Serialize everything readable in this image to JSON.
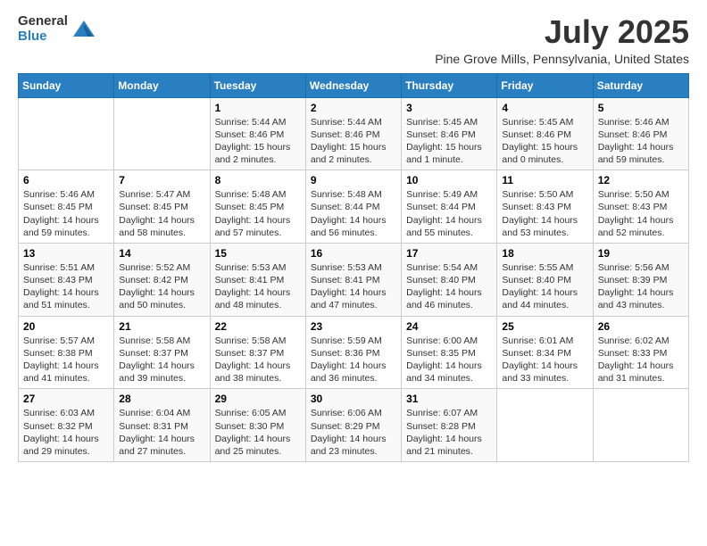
{
  "logo": {
    "general": "General",
    "blue": "Blue"
  },
  "title": "July 2025",
  "subtitle": "Pine Grove Mills, Pennsylvania, United States",
  "days_of_week": [
    "Sunday",
    "Monday",
    "Tuesday",
    "Wednesday",
    "Thursday",
    "Friday",
    "Saturday"
  ],
  "weeks": [
    [
      {
        "day": "",
        "info": ""
      },
      {
        "day": "",
        "info": ""
      },
      {
        "day": "1",
        "info": "Sunrise: 5:44 AM\nSunset: 8:46 PM\nDaylight: 15 hours and 2 minutes."
      },
      {
        "day": "2",
        "info": "Sunrise: 5:44 AM\nSunset: 8:46 PM\nDaylight: 15 hours and 2 minutes."
      },
      {
        "day": "3",
        "info": "Sunrise: 5:45 AM\nSunset: 8:46 PM\nDaylight: 15 hours and 1 minute."
      },
      {
        "day": "4",
        "info": "Sunrise: 5:45 AM\nSunset: 8:46 PM\nDaylight: 15 hours and 0 minutes."
      },
      {
        "day": "5",
        "info": "Sunrise: 5:46 AM\nSunset: 8:46 PM\nDaylight: 14 hours and 59 minutes."
      }
    ],
    [
      {
        "day": "6",
        "info": "Sunrise: 5:46 AM\nSunset: 8:45 PM\nDaylight: 14 hours and 59 minutes."
      },
      {
        "day": "7",
        "info": "Sunrise: 5:47 AM\nSunset: 8:45 PM\nDaylight: 14 hours and 58 minutes."
      },
      {
        "day": "8",
        "info": "Sunrise: 5:48 AM\nSunset: 8:45 PM\nDaylight: 14 hours and 57 minutes."
      },
      {
        "day": "9",
        "info": "Sunrise: 5:48 AM\nSunset: 8:44 PM\nDaylight: 14 hours and 56 minutes."
      },
      {
        "day": "10",
        "info": "Sunrise: 5:49 AM\nSunset: 8:44 PM\nDaylight: 14 hours and 55 minutes."
      },
      {
        "day": "11",
        "info": "Sunrise: 5:50 AM\nSunset: 8:43 PM\nDaylight: 14 hours and 53 minutes."
      },
      {
        "day": "12",
        "info": "Sunrise: 5:50 AM\nSunset: 8:43 PM\nDaylight: 14 hours and 52 minutes."
      }
    ],
    [
      {
        "day": "13",
        "info": "Sunrise: 5:51 AM\nSunset: 8:43 PM\nDaylight: 14 hours and 51 minutes."
      },
      {
        "day": "14",
        "info": "Sunrise: 5:52 AM\nSunset: 8:42 PM\nDaylight: 14 hours and 50 minutes."
      },
      {
        "day": "15",
        "info": "Sunrise: 5:53 AM\nSunset: 8:41 PM\nDaylight: 14 hours and 48 minutes."
      },
      {
        "day": "16",
        "info": "Sunrise: 5:53 AM\nSunset: 8:41 PM\nDaylight: 14 hours and 47 minutes."
      },
      {
        "day": "17",
        "info": "Sunrise: 5:54 AM\nSunset: 8:40 PM\nDaylight: 14 hours and 46 minutes."
      },
      {
        "day": "18",
        "info": "Sunrise: 5:55 AM\nSunset: 8:40 PM\nDaylight: 14 hours and 44 minutes."
      },
      {
        "day": "19",
        "info": "Sunrise: 5:56 AM\nSunset: 8:39 PM\nDaylight: 14 hours and 43 minutes."
      }
    ],
    [
      {
        "day": "20",
        "info": "Sunrise: 5:57 AM\nSunset: 8:38 PM\nDaylight: 14 hours and 41 minutes."
      },
      {
        "day": "21",
        "info": "Sunrise: 5:58 AM\nSunset: 8:37 PM\nDaylight: 14 hours and 39 minutes."
      },
      {
        "day": "22",
        "info": "Sunrise: 5:58 AM\nSunset: 8:37 PM\nDaylight: 14 hours and 38 minutes."
      },
      {
        "day": "23",
        "info": "Sunrise: 5:59 AM\nSunset: 8:36 PM\nDaylight: 14 hours and 36 minutes."
      },
      {
        "day": "24",
        "info": "Sunrise: 6:00 AM\nSunset: 8:35 PM\nDaylight: 14 hours and 34 minutes."
      },
      {
        "day": "25",
        "info": "Sunrise: 6:01 AM\nSunset: 8:34 PM\nDaylight: 14 hours and 33 minutes."
      },
      {
        "day": "26",
        "info": "Sunrise: 6:02 AM\nSunset: 8:33 PM\nDaylight: 14 hours and 31 minutes."
      }
    ],
    [
      {
        "day": "27",
        "info": "Sunrise: 6:03 AM\nSunset: 8:32 PM\nDaylight: 14 hours and 29 minutes."
      },
      {
        "day": "28",
        "info": "Sunrise: 6:04 AM\nSunset: 8:31 PM\nDaylight: 14 hours and 27 minutes."
      },
      {
        "day": "29",
        "info": "Sunrise: 6:05 AM\nSunset: 8:30 PM\nDaylight: 14 hours and 25 minutes."
      },
      {
        "day": "30",
        "info": "Sunrise: 6:06 AM\nSunset: 8:29 PM\nDaylight: 14 hours and 23 minutes."
      },
      {
        "day": "31",
        "info": "Sunrise: 6:07 AM\nSunset: 8:28 PM\nDaylight: 14 hours and 21 minutes."
      },
      {
        "day": "",
        "info": ""
      },
      {
        "day": "",
        "info": ""
      }
    ]
  ]
}
